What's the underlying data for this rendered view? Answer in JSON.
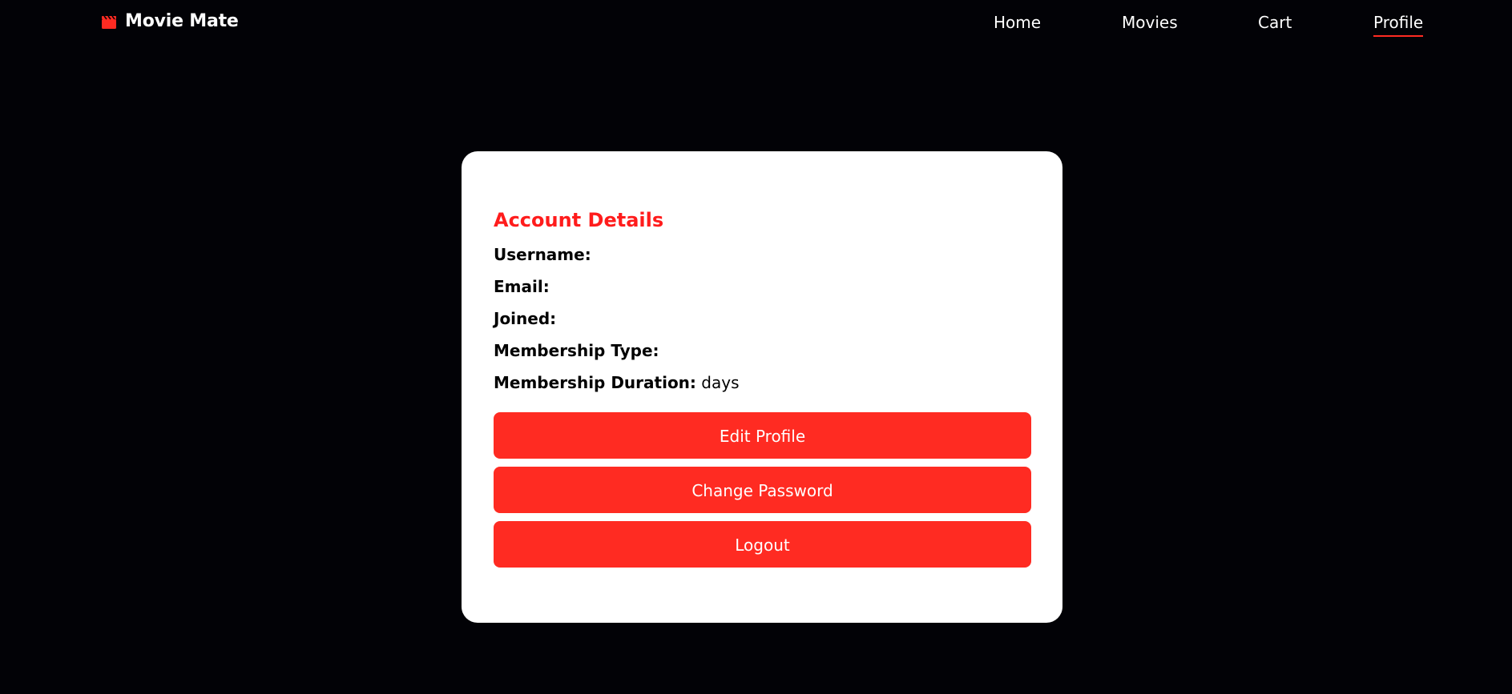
{
  "app": {
    "brand": "Movie Mate",
    "brand_icon": "clapperboard-icon",
    "accent_color": "#ff2b22",
    "title_color": "#ff1c1c",
    "background_color": "#020206"
  },
  "nav": {
    "items": [
      {
        "label": "Home",
        "active": false
      },
      {
        "label": "Movies",
        "active": false
      },
      {
        "label": "Cart",
        "active": false
      },
      {
        "label": "Profile",
        "active": true
      }
    ]
  },
  "account": {
    "title": "Account Details",
    "fields": [
      {
        "label": "Username:",
        "value": ""
      },
      {
        "label": "Email:",
        "value": ""
      },
      {
        "label": "Joined:",
        "value": ""
      },
      {
        "label": "Membership Type:",
        "value": ""
      },
      {
        "label": "Membership Duration:",
        "value": "days"
      }
    ],
    "buttons": {
      "edit_profile": "Edit Profile",
      "change_password": "Change Password",
      "logout": "Logout"
    }
  }
}
